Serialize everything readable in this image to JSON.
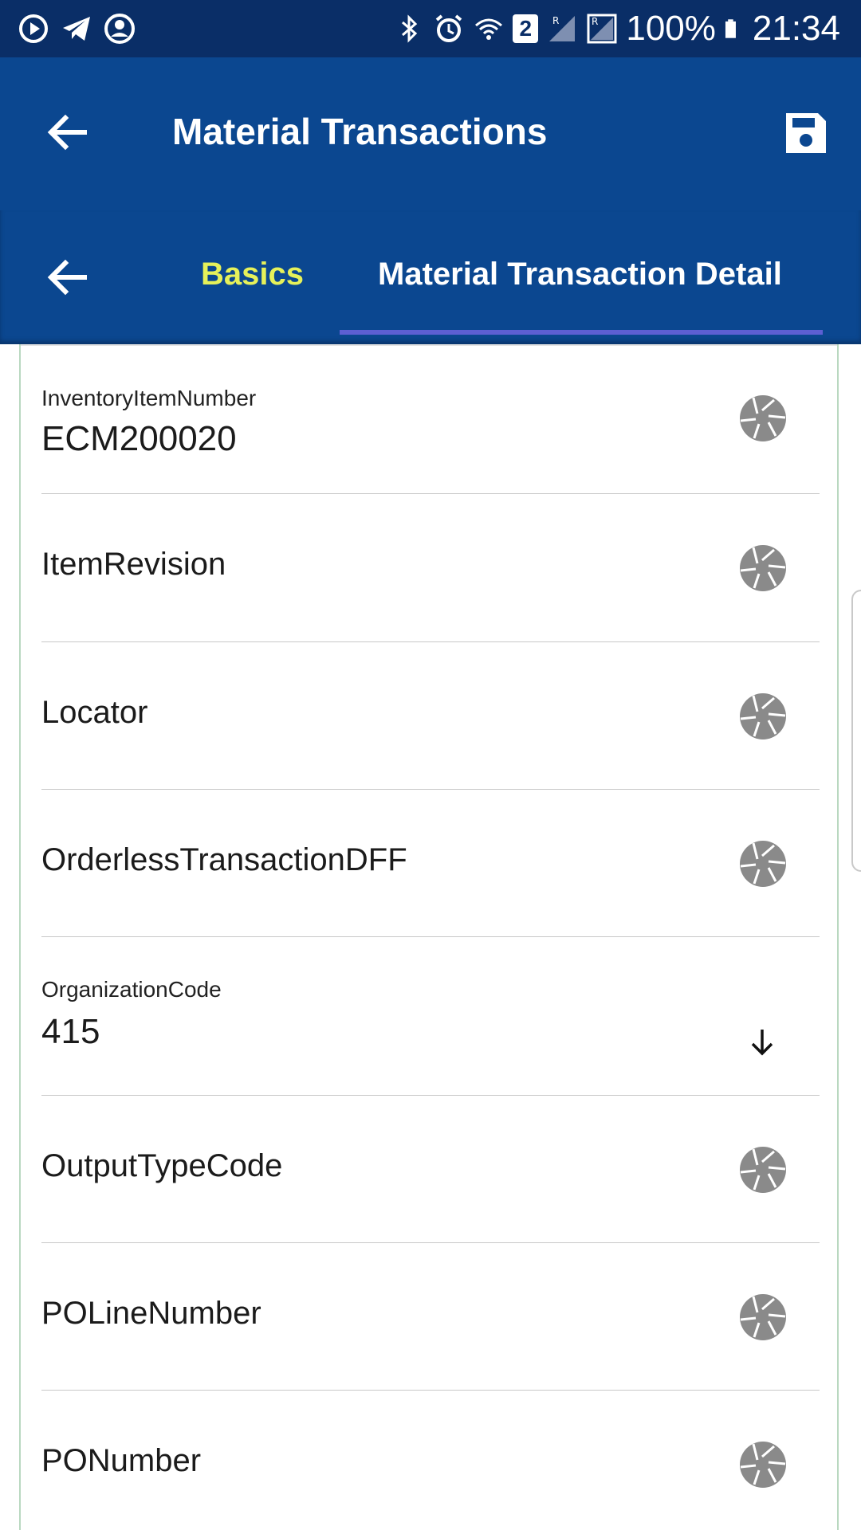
{
  "status_bar": {
    "battery_text": "100%",
    "time": "21:34",
    "notif_badge": "2",
    "icons_left": [
      "media-play-icon",
      "telegram-icon",
      "account-icon"
    ],
    "icons_right": [
      "bluetooth-icon",
      "alarm-icon",
      "wifi-icon",
      "signal-icon",
      "roaming-signal-icon",
      "battery-icon"
    ]
  },
  "app_bar": {
    "title": "Material Transactions",
    "back_icon": "arrow-back-icon",
    "save_icon": "save-icon"
  },
  "tabs": {
    "back_icon": "arrow-back-icon",
    "items": [
      {
        "label": "Basics",
        "active": false
      },
      {
        "label": "Material Transaction Detail",
        "active": true
      }
    ]
  },
  "fields": [
    {
      "label": "InventoryItemNumber",
      "value": "ECM200020",
      "icon": "aperture-icon"
    },
    {
      "label": "ItemRevision",
      "value": "",
      "icon": "aperture-icon"
    },
    {
      "label": "Locator",
      "value": "",
      "icon": "aperture-icon"
    },
    {
      "label": "OrderlessTransactionDFF",
      "value": "",
      "icon": "aperture-icon"
    },
    {
      "label": "OrganizationCode",
      "value": "415",
      "icon": "arrow-down-icon"
    },
    {
      "label": "OutputTypeCode",
      "value": "",
      "icon": "aperture-icon"
    },
    {
      "label": "POLineNumber",
      "value": "",
      "icon": "aperture-icon"
    },
    {
      "label": "PONumber",
      "value": "",
      "icon": "aperture-icon"
    }
  ],
  "colors": {
    "status_bar": "#0a2e67",
    "app_bar": "#0b4790",
    "active_tab_underline": "#5d5fd3",
    "inactive_tab_text": "#e6f15a",
    "icon_gray": "#8a8a8a"
  }
}
